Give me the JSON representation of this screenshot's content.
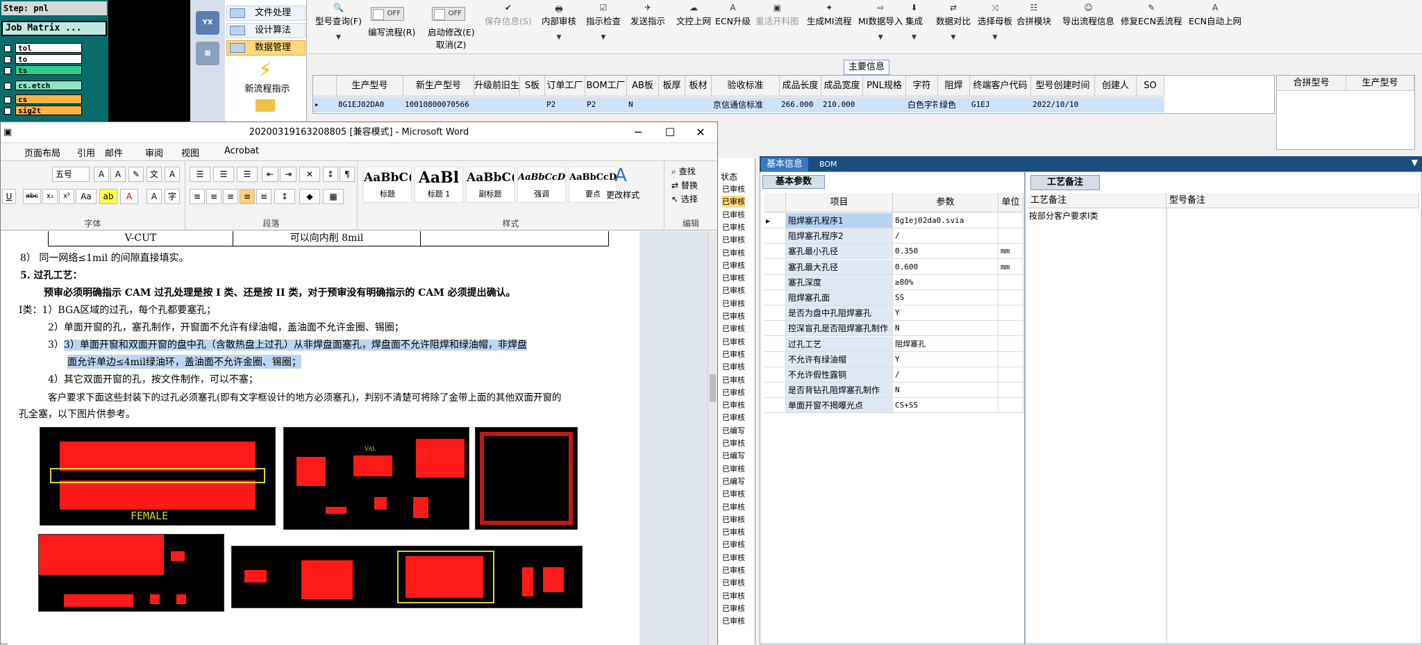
{
  "cam": {
    "step": "Step: pnl",
    "job_matrix": "Job Matrix ...",
    "layers": [
      {
        "name": "tol",
        "color": "#ffffff"
      },
      {
        "name": "to",
        "color": "#ffffff"
      },
      {
        "name": "ts",
        "color": "#2ad08a"
      },
      {
        "name": "cs.etch",
        "color": "#8fe5c9"
      },
      {
        "name": "cs",
        "color": "#ffb347"
      },
      {
        "name": "sig2t",
        "color": "#ffb347"
      }
    ]
  },
  "nav_menu": {
    "items": [
      "文件处理",
      "设计算法",
      "数据管理"
    ],
    "selected_index": 2,
    "new_process": "新流程指示"
  },
  "toolbar": {
    "model_query": "型号查询(F)",
    "write_flow": "编写流程(R)",
    "auto_modify": "启动修改(E)",
    "cancel": "取消(Z)",
    "toggle_off": "OFF",
    "buttons": [
      "保存信息(S)",
      "内部审核",
      "指示检查",
      "发送指示",
      "文控上网",
      "ECN升级",
      "重活开料图",
      "生成MI流程",
      "MI数据导入",
      "集成",
      "数据对比",
      "选择母板",
      "合拼模块",
      "导出流程信息",
      "修复ECN丢流程",
      "ECN自动上网"
    ],
    "disabled": [
      "保存信息(S)",
      "重活开料图"
    ]
  },
  "main_info": {
    "label": "主要信息",
    "columns": [
      "生产型号",
      "新生产型号",
      "升级前旧生产型号",
      "S板",
      "订单工厂",
      "BOM工厂",
      "AB板",
      "板厚",
      "板材",
      "验收标准",
      "成品长度",
      "成品宽度",
      "PNL规格",
      "字符",
      "阻焊",
      "终端客户代码",
      "型号创建时间",
      "创建人",
      "SO"
    ],
    "row": [
      "8G1EJ02DA0",
      "10010800070566",
      "",
      "",
      "P2",
      "P2",
      "N",
      "",
      "",
      "京信通信标准",
      "266.000",
      "210.000",
      "",
      "白色字符",
      "绿色",
      "G1EJ",
      "2022/10/10",
      "",
      ""
    ]
  },
  "merge_grid": {
    "columns": [
      "合拼型号",
      "生产型号"
    ]
  },
  "word": {
    "title": "20200319163208805 [兼容模式] - Microsoft Word",
    "tabs": [
      "页面布局",
      "引用",
      "邮件",
      "审阅",
      "视图",
      "Acrobat"
    ],
    "font_size": "五号",
    "groups": [
      "字体",
      "段落",
      "样式",
      "编辑"
    ],
    "styles": [
      {
        "preview": "AaBbC(",
        "name": "标题"
      },
      {
        "preview": "AaBl",
        "name": "标题 1"
      },
      {
        "preview": "AaBbC(",
        "name": "副标题"
      },
      {
        "preview": "AaBbCcD",
        "name": "强调"
      },
      {
        "preview": "AaBbCcD",
        "name": "要点"
      }
    ],
    "change_styles": "更改样式",
    "find": "查找",
    "replace": "替换",
    "select": "选择",
    "doc": {
      "table_cells": [
        "V-CUT",
        "可以向内削 8mil"
      ],
      "lines": [
        "8） 同一网络≤1mil 的间隙直接填实。",
        "5.    过孔工艺：",
        "预审必须明确指示 CAM 过孔处理是按 I 类、还是按 II 类，对于预审没有明确指示的 CAM 必须提出确认。",
        "I类：1）BGA区域的过孔，每个孔都要塞孔；",
        "2）单面开窗的孔，塞孔制作，开窗面不允许有绿油帽，盖油面不允许金圈、锡圈；",
        "3）单面开窗和双面开窗的盘中孔（含散热盘上过孔）从非焊盘面塞孔，焊盘面不允许阻焊和绿油帽，非焊盘",
        "面允许单边≤4mil绿油环，盖油面不允许金圈、锡圈；",
        "4）其它双面开窗的孔，按文件制作，可以不塞；",
        "客户要求下面这些封装下的过孔必须塞孔(即有文字框设计的地方必须塞孔)，判别不清楚可将除了金带上面的其他双面开窗的",
        "孔全塞，以下图片供参考。"
      ],
      "pcb_labels": [
        "FEMALE",
        "VAL"
      ]
    }
  },
  "status_list": {
    "header": "状态",
    "items": [
      "已审核",
      "已审核",
      "已审核",
      "已审核",
      "已审核",
      "已审核",
      "已审核",
      "已审核",
      "已审核",
      "已审核",
      "已审核",
      "已审核",
      "已审核",
      "已审核",
      "已审核",
      "已审核",
      "已审核",
      "已审核",
      "已审核",
      "已编写",
      "已审核",
      "已编写",
      "已审核",
      "已编写",
      "已审核",
      "已审核",
      "已审核",
      "已审核",
      "已审核",
      "已审核",
      "已审核",
      "已审核",
      "已审核",
      "已审核",
      "已审核"
    ]
  },
  "detail_tabs": {
    "active": "基本信息",
    "other": "BOM"
  },
  "basic_params": {
    "tab": "基本参数",
    "columns": [
      "项目",
      "参数",
      "单位"
    ],
    "rows": [
      {
        "item": "阻焊塞孔程序1",
        "value": "8g1ej02da0.svia",
        "unit": ""
      },
      {
        "item": "阻焊塞孔程序2",
        "value": "/",
        "unit": ""
      },
      {
        "item": "塞孔最小孔径",
        "value": "0.350",
        "unit": "mm"
      },
      {
        "item": "塞孔最大孔径",
        "value": "0.600",
        "unit": "mm"
      },
      {
        "item": "塞孔深度",
        "value": "≥80%",
        "unit": ""
      },
      {
        "item": "阻焊塞孔面",
        "value": "SS",
        "unit": ""
      },
      {
        "item": "是否为盘中孔阻焊塞孔",
        "value": "Y",
        "unit": ""
      },
      {
        "item": "控深盲孔是否阻焊塞孔制作",
        "value": "N",
        "unit": ""
      },
      {
        "item": "过孔工艺",
        "value": "阻焊塞孔",
        "unit": ""
      },
      {
        "item": "不允许有绿油帽",
        "value": "Y",
        "unit": ""
      },
      {
        "item": "不允许假性露铜",
        "value": "/",
        "unit": ""
      },
      {
        "item": "是否背钻孔阻焊塞孔制作",
        "value": "N",
        "unit": ""
      },
      {
        "item": "单面开窗不揭曝光点",
        "value": "CS+SS",
        "unit": ""
      }
    ]
  },
  "process_notes": {
    "tab": "工艺备注",
    "columns": [
      "工艺备注",
      "型号备注"
    ],
    "note": "按部分客户要求I类"
  }
}
